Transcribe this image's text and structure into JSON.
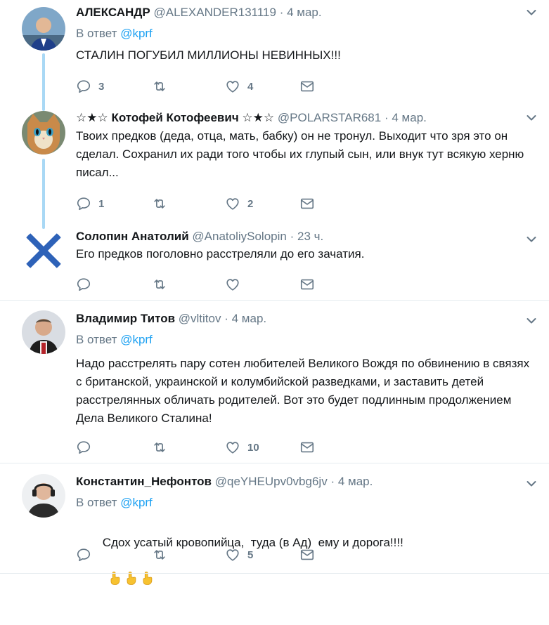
{
  "tweets": [
    {
      "name": "АЛЕКСАНДР",
      "handle": "@ALEXANDER131119",
      "time": "4 мар.",
      "reply_prefix": "В ответ",
      "reply_to": "@kprf",
      "text": "СТАЛИН ПОГУБИЛ МИЛЛИОНЫ НЕВИННЫХ!!!",
      "replies": "3",
      "retweets": "",
      "likes": "4"
    },
    {
      "name": "☆★☆ Котофей Котофеевич ☆★☆",
      "handle": "@POLARSTAR681",
      "time": "4 мар.",
      "text": "Твоих предков (деда, отца, мать, бабку) он не тронул. Выходит что зря это он сделал. Сохранил их ради того чтобы их глупый сын, или внук тут всякую херню писал...",
      "replies": "1",
      "retweets": "",
      "likes": "2"
    },
    {
      "name": "Солопин Анатолий",
      "handle": "@AnatoliySolopin",
      "time": "23 ч.",
      "text": "Его предков поголовно расстреляли до его зачатия.",
      "replies": "",
      "retweets": "",
      "likes": ""
    },
    {
      "name": "Владимир Титов",
      "handle": "@vltitov",
      "time": "4 мар.",
      "reply_prefix": "В ответ",
      "reply_to": "@kprf",
      "text": "Надо расстрелять пару сотен любителей Великого Вождя по обвинению в связях с британской, украинской и колумбийской разведками, и заставить детей расстрелянных обличать родителей. Вот это будет подлинным продолжением Дела Великого Сталина!",
      "replies": "",
      "retweets": "",
      "likes": "10"
    },
    {
      "name": "Константин_Нефонтов",
      "handle": "@qeYHEUpv0vbg6jv",
      "time": "4 мар.",
      "reply_prefix": "В ответ",
      "reply_to": "@kprf",
      "text": "Сдох усатый кровопийца,  туда (в Ад)  ему и дорога!!!!",
      "replies": "",
      "retweets": "",
      "likes": "5"
    }
  ],
  "dot": "·",
  "icons": [
    "reply-icon",
    "retweet-icon",
    "like-icon",
    "message-icon",
    "chevron-down-icon",
    "middle-finger-emoji"
  ],
  "colors": {
    "accent": "#1da1f2",
    "muted": "#657786",
    "thread": "#a9d8f5",
    "divider": "#e6ecf0"
  }
}
